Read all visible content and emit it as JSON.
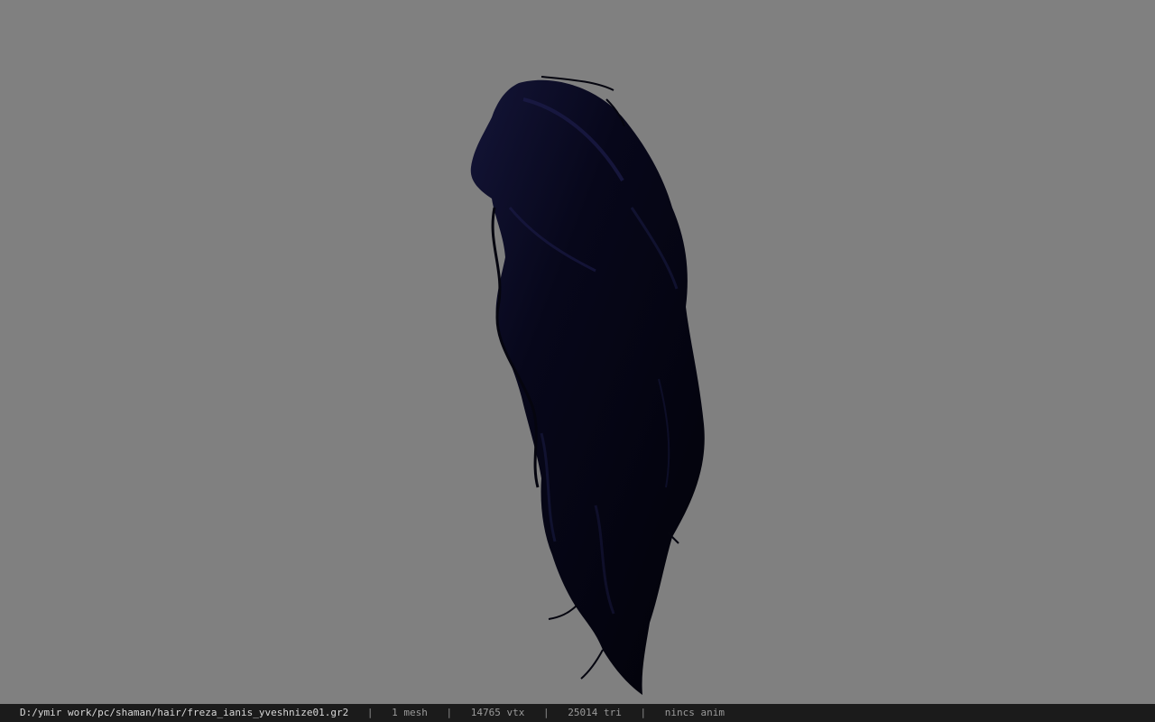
{
  "colors": {
    "background": "#808080",
    "hair_dark": "#05050f",
    "hair_highlight": "#1c1d4a",
    "status_bar_bg": "#1b1b1b"
  },
  "viewport": {
    "model_icon": "hair-model"
  },
  "status_bar": {
    "file_path": "D:/ymir work/pc/shaman/hair/freza_ianis_yveshnize01.gr2",
    "separator": "|",
    "mesh_count": "1 mesh",
    "vertex_count": "14765 vtx",
    "triangle_count": "25014 tri",
    "anim_status": "nincs anim"
  }
}
